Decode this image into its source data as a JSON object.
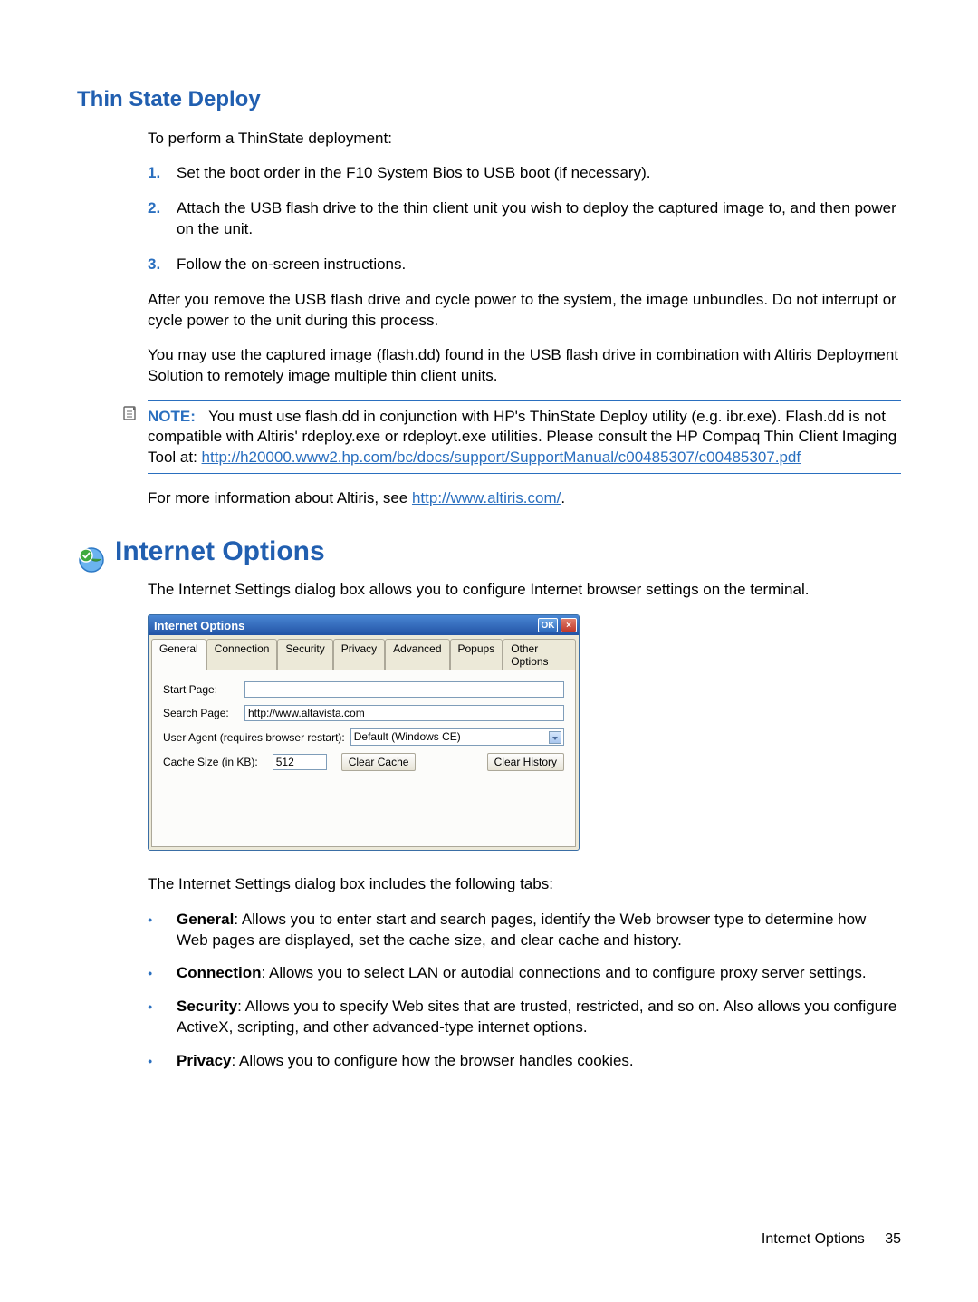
{
  "heading_thinstate": "Thin State Deploy",
  "intro_thinstate": "To perform a ThinState deployment:",
  "steps": [
    {
      "n": "1.",
      "t": "Set the boot order in the F10 System Bios to USB boot (if necessary)."
    },
    {
      "n": "2.",
      "t": "Attach the USB flash drive to the thin client unit you wish to deploy the captured image to, and then power on the unit."
    },
    {
      "n": "3.",
      "t": "Follow the on-screen instructions."
    }
  ],
  "after_p1": "After you remove the USB flash drive and cycle power to the system, the image unbundles. Do not interrupt or cycle power to the unit during this process.",
  "after_p2": "You may use the captured image (flash.dd) found in the USB flash drive in combination with Altiris Deployment Solution to remotely image multiple thin client units.",
  "note_label": "NOTE:",
  "note_body_pre": "You must use flash.dd in conjunction with HP's ThinState Deploy utility (e.g. ibr.exe). Flash.dd is not compatible with Altiris' rdeploy.exe or rdeployt.exe utilities. Please consult the HP Compaq Thin Client Imaging Tool at: ",
  "note_link": "http://h20000.www2.hp.com/bc/docs/support/SupportManual/c00485307/c00485307.pdf",
  "altiris_p_pre": "For more information about Altiris, see ",
  "altiris_link": "http://www.altiris.com/",
  "altiris_p_post": ".",
  "heading_internet": "Internet Options",
  "internet_intro": "The Internet Settings dialog box allows you to configure Internet browser settings on the terminal.",
  "dialog": {
    "title": "Internet Options",
    "ok": "OK",
    "close": "×",
    "tabs": [
      "General",
      "Connection",
      "Security",
      "Privacy",
      "Advanced",
      "Popups",
      "Other Options"
    ],
    "labels": {
      "start_page": "Start Page:",
      "search_page": "Search Page:",
      "user_agent": "User Agent (requires browser restart):",
      "cache_size": "Cache Size (in KB):"
    },
    "values": {
      "start_page": "",
      "search_page": "http://www.altavista.com",
      "user_agent": "Default (Windows CE)",
      "cache_size": "512"
    },
    "buttons": {
      "clear_cache_pre": "Clear ",
      "clear_cache_ul": "C",
      "clear_cache_post": "ache",
      "clear_history_pre": "Clear His",
      "clear_history_ul": "t",
      "clear_history_post": "ory"
    }
  },
  "tabs_intro": "The Internet Settings dialog box includes the following tabs:",
  "tab_descs": [
    {
      "b": "General",
      "t": ": Allows you to enter start and search pages, identify the Web browser type to determine how Web pages are displayed, set the cache size, and clear cache and history."
    },
    {
      "b": "Connection",
      "t": ": Allows you to select LAN or autodial connections and to configure proxy server settings."
    },
    {
      "b": "Security",
      "t": ": Allows you to specify Web sites that are trusted, restricted, and so on. Also allows you configure ActiveX, scripting, and other advanced-type internet options."
    },
    {
      "b": "Privacy",
      "t": ": Allows you to configure how the browser handles cookies."
    }
  ],
  "footer_label": "Internet Options",
  "footer_page": "35"
}
